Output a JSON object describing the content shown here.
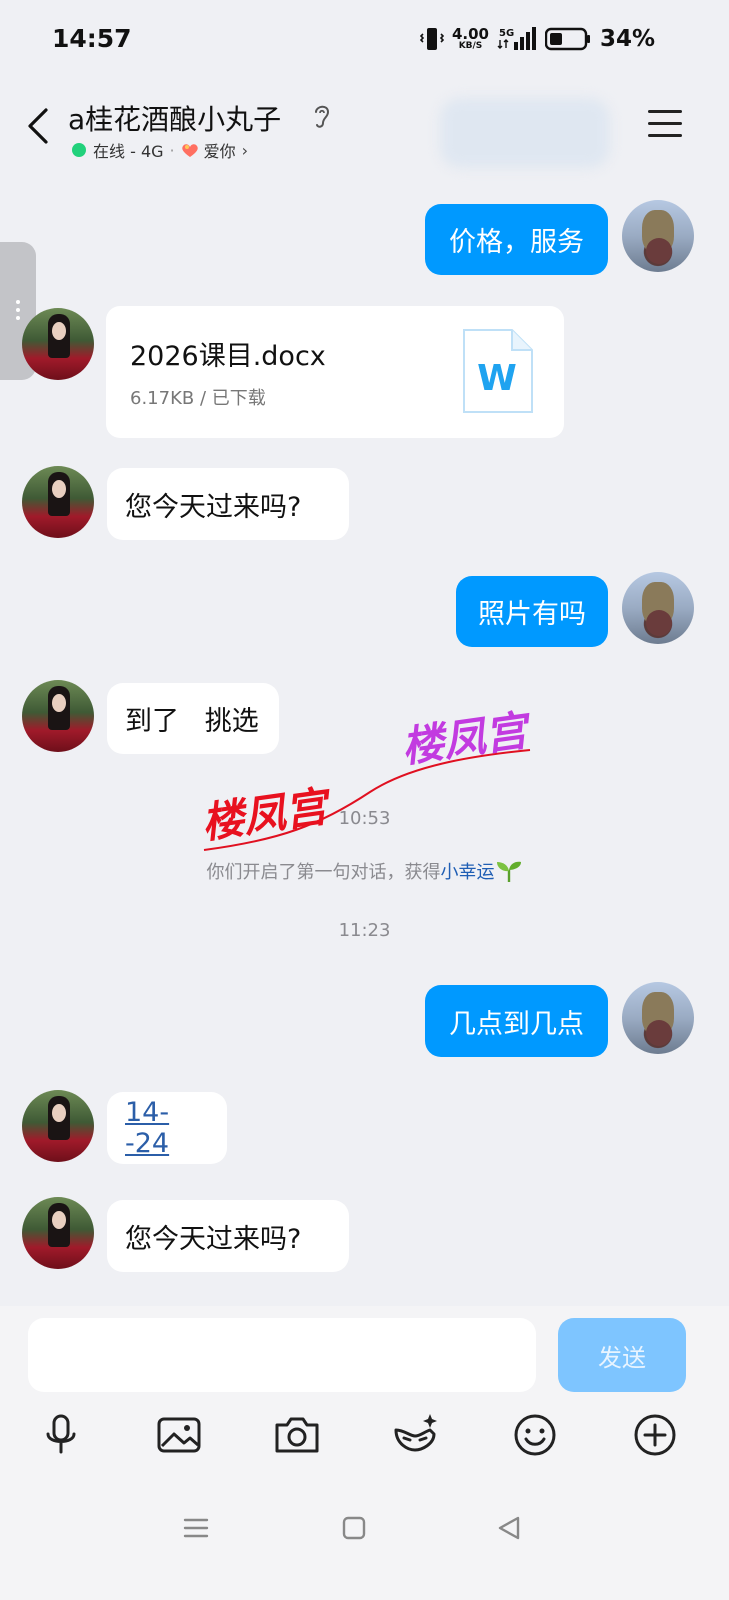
{
  "status_bar": {
    "time": "14:57",
    "net_speed_value": "4.00",
    "net_speed_unit": "KB/S",
    "network": "5G",
    "battery": "34%"
  },
  "header": {
    "title": "a桂花酒酿小丸子",
    "status_online": "在线 - 4G",
    "separator": "·",
    "relation": "爱你"
  },
  "file_message": {
    "name": "2026课目.docx",
    "meta": "6.17KB / 已下载",
    "icon_letter": "W"
  },
  "messages": {
    "m1": "价格，服务",
    "m3": "您今天过来吗?",
    "m4": "照片有吗",
    "m5": "到了   挑选",
    "m6": "几点到几点",
    "m7": "14--24",
    "m8": "您今天过来吗?"
  },
  "watermark": {
    "text": "楼凤宫"
  },
  "timestamps": {
    "t1": "10:53",
    "t2": "11:23"
  },
  "system_message": {
    "prefix": "你们开启了第一句对话，获得",
    "highlight": "小幸运"
  },
  "input": {
    "placeholder": "",
    "send_label": "发送"
  },
  "colors": {
    "bubble_out": "#0099ff",
    "bubble_in": "#ffffff",
    "online": "#21d17b",
    "send_disabled": "#7ec5ff"
  },
  "icons": {
    "toolbar": [
      "microphone-icon",
      "image-icon",
      "camera-icon",
      "mask-sparkle-icon",
      "emoji-icon",
      "plus-icon"
    ],
    "nav": [
      "menu-lines-icon",
      "home-square-icon",
      "back-triangle-icon"
    ]
  }
}
